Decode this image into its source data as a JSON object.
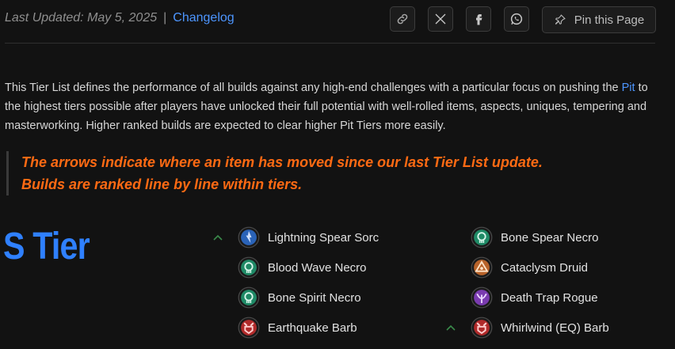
{
  "meta": {
    "last_updated": "Last Updated:  May 5, 2025",
    "separator": "|",
    "changelog": "Changelog"
  },
  "share": {
    "link_icon": "link-icon",
    "x_icon": "x-icon",
    "facebook_icon": "facebook-icon",
    "whatsapp_icon": "whatsapp-icon"
  },
  "pin": {
    "label": "Pin this Page",
    "icon": "pin-icon"
  },
  "description": {
    "part1": "This Tier List defines the performance of all builds against any high-end challenges with a particular focus on pushing the ",
    "pit_link": "Pit",
    "part2": " to the highest tiers possible after players have unlocked their full potential with well-rolled items, aspects, uniques, tempering and masterworking. Higher ranked builds are expected to clear higher Pit Tiers more easily."
  },
  "callout": {
    "line1": "The arrows indicate where an item has moved since our last Tier List update.",
    "line2": "Builds are ranked line by line within tiers."
  },
  "tier": {
    "label": "S Tier",
    "builds": [
      {
        "name": "Lightning Spear Sorc",
        "class": "sorcerer",
        "arrow": "up",
        "color": "#2a63b8"
      },
      {
        "name": "Bone Spear Necro",
        "class": "necromancer",
        "arrow": "",
        "color": "#1f8a66"
      },
      {
        "name": "Blood Wave Necro",
        "class": "necromancer",
        "arrow": "",
        "color": "#1f8a66"
      },
      {
        "name": "Cataclysm Druid",
        "class": "druid",
        "arrow": "",
        "color": "#b8632a"
      },
      {
        "name": "Bone Spirit Necro",
        "class": "necromancer",
        "arrow": "",
        "color": "#1f8a66"
      },
      {
        "name": "Death Trap Rogue",
        "class": "rogue",
        "arrow": "",
        "color": "#7a3bb0"
      },
      {
        "name": "Earthquake Barb",
        "class": "barbarian",
        "arrow": "",
        "color": "#b02a2a"
      },
      {
        "name": "Whirlwind (EQ) Barb",
        "class": "barbarian",
        "arrow": "up",
        "color": "#b02a2a"
      }
    ]
  },
  "colors": {
    "accent_blue": "#2f80ff",
    "callout_orange": "#ff6a13",
    "arrow_green": "#3a8a4a"
  }
}
